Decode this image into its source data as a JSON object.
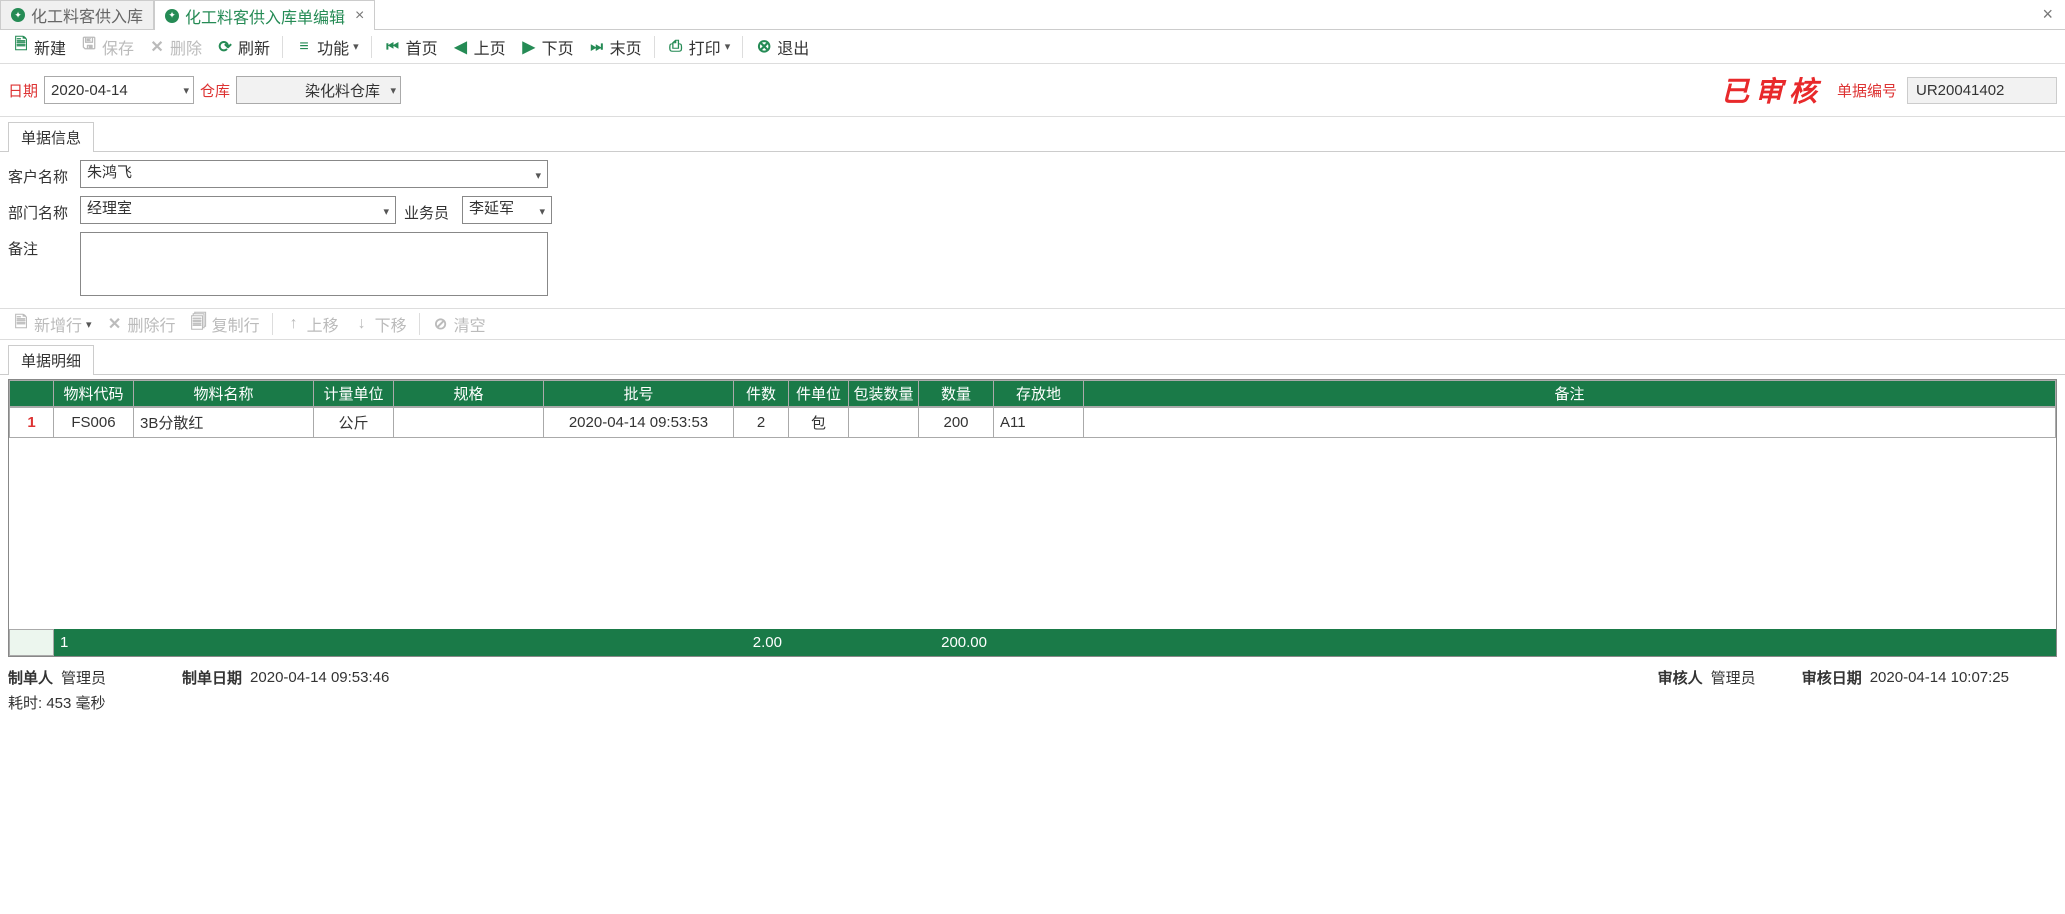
{
  "tabs": {
    "list": "化工料客供入库",
    "edit": "化工料客供入库单编辑"
  },
  "toolbar": {
    "new": "新建",
    "save": "保存",
    "delete": "删除",
    "refresh": "刷新",
    "func": "功能",
    "first": "首页",
    "prev": "上页",
    "next": "下页",
    "last": "末页",
    "print": "打印",
    "exit": "退出"
  },
  "filter": {
    "date_label": "日期",
    "date_value": "2020-04-14",
    "wh_label": "仓库",
    "wh_value": "染化料仓库",
    "stamp": "已审核",
    "code_label": "单据编号",
    "code_value": "UR20041402"
  },
  "sections": {
    "info": "单据信息",
    "detail": "单据明细"
  },
  "form": {
    "cust_label": "客户名称",
    "cust_value": "朱鸿飞",
    "dept_label": "部门名称",
    "dept_value": "经理室",
    "sales_label": "业务员",
    "sales_value": "李延军",
    "remark_label": "备注",
    "remark_value": ""
  },
  "rowbar": {
    "add": "新增行",
    "del": "删除行",
    "copy": "复制行",
    "up": "上移",
    "down": "下移",
    "clear": "清空"
  },
  "grid": {
    "headers": {
      "code": "物料代码",
      "name": "物料名称",
      "uom": "计量单位",
      "spec": "规格",
      "batch": "批号",
      "pcs": "件数",
      "pcs_unit": "件单位",
      "pack_qty": "包装数量",
      "qty": "数量",
      "loc": "存放地",
      "remark": "备注"
    },
    "rows": [
      {
        "rownum": "1",
        "code": "FS006",
        "name": "3B分散红",
        "uom": "公斤",
        "spec": "",
        "batch": "2020-04-14 09:53:53",
        "pcs": "2",
        "pcs_unit": "包",
        "pack_qty": "",
        "qty": "200",
        "loc": "A11",
        "remark": ""
      }
    ],
    "totals": {
      "count": "1",
      "pcs": "2.00",
      "qty": "200.00"
    }
  },
  "footer": {
    "creator_label": "制单人",
    "creator": "管理员",
    "create_date_label": "制单日期",
    "create_date": "2020-04-14 09:53:46",
    "auditor_label": "审核人",
    "auditor": "管理员",
    "audit_date_label": "审核日期",
    "audit_date": "2020-04-14 10:07:25",
    "elapsed": "耗时: 453 毫秒"
  }
}
